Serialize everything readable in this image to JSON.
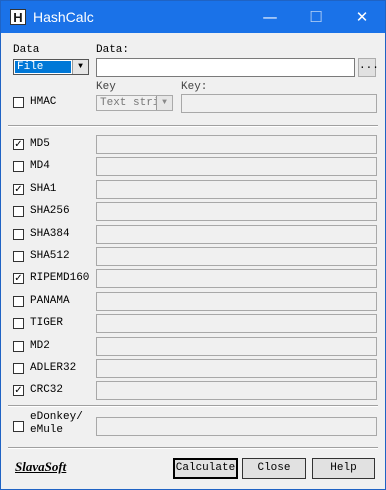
{
  "window": {
    "title": "HashCalc"
  },
  "titlebar": {
    "min_glyph": "—",
    "max_glyph": "☐",
    "close_glyph": "✕",
    "app_icon_glyph": "H"
  },
  "data_section": {
    "data_type_label": "Data",
    "data_type_value": "File",
    "data_label": "Data:",
    "data_value": "",
    "browse_label": "..."
  },
  "hmac": {
    "label": "HMAC",
    "checked": false,
    "key_type_label": "Key",
    "key_type_value": "Text stri",
    "key_label": "Key:",
    "key_value": ""
  },
  "algorithms": [
    {
      "name": "MD5",
      "checked": true,
      "value": ""
    },
    {
      "name": "MD4",
      "checked": false,
      "value": ""
    },
    {
      "name": "SHA1",
      "checked": true,
      "value": ""
    },
    {
      "name": "SHA256",
      "checked": false,
      "value": ""
    },
    {
      "name": "SHA384",
      "checked": false,
      "value": ""
    },
    {
      "name": "SHA512",
      "checked": false,
      "value": ""
    },
    {
      "name": "RIPEMD160",
      "checked": true,
      "value": ""
    },
    {
      "name": "PANAMA",
      "checked": false,
      "value": ""
    },
    {
      "name": "TIGER",
      "checked": false,
      "value": ""
    },
    {
      "name": "MD2",
      "checked": false,
      "value": ""
    },
    {
      "name": "ADLER32",
      "checked": false,
      "value": ""
    },
    {
      "name": "CRC32",
      "checked": true,
      "value": ""
    }
  ],
  "edonkey": {
    "label_line1": "eDonkey/",
    "label_line2": "eMule",
    "checked": false,
    "value": ""
  },
  "footer": {
    "logo": "SlavaSoft",
    "calculate_label": "Calculate",
    "close_label": "Close",
    "help_label": "Help"
  },
  "check_glyph": "✓",
  "dropdown_arrow_glyph": "▼"
}
